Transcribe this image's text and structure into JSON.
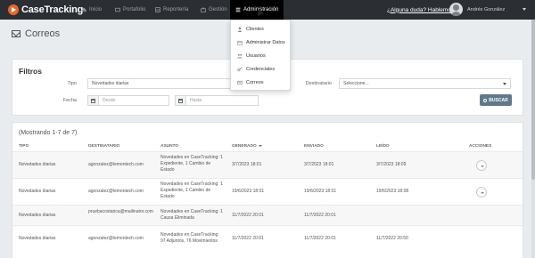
{
  "app": {
    "logo": "CaseTracking"
  },
  "nav": {
    "items": [
      {
        "label": "Inicio",
        "icon": "home-icon"
      },
      {
        "label": "Portafolio",
        "icon": "folder-icon"
      },
      {
        "label": "Reportería",
        "icon": "chart-icon"
      },
      {
        "label": "Gestión",
        "icon": "briefcase-icon"
      },
      {
        "label": "Administración",
        "icon": "menu-icon"
      }
    ],
    "help": "¿Alguna duda? Hablemos",
    "user": "Andrés González"
  },
  "page": {
    "title": "Correos",
    "icon": "envelope-icon"
  },
  "filters": {
    "title": "Filtros",
    "tipo_label": "Tipo",
    "tipo_value": "Novedades diarias",
    "destinatario_label": "Destinatario",
    "destinatario_value": "Seleccione...",
    "fecha_label": "Fecha",
    "desde_placeholder": "Desde",
    "hasta_placeholder": "Hasta",
    "search_button": "BUSCAR"
  },
  "results": {
    "count": "(Mostrando 1-7 de 7)",
    "columns": [
      "TIPO",
      "DESTINATARIO",
      "ASUNTO",
      "GENERADO",
      "ENVIADO",
      "LEÍDO",
      "ACCIONES"
    ],
    "rows": [
      {
        "tipo": "Novedades diarias",
        "destinatario": "agonzalez@lemontech.com",
        "asunto": "Novedades en CaseTracking: 1 Expediente, 1 Cambio de Estado",
        "generado": "3/7/2023 18:01",
        "enviado": "3/7/2023 18:01",
        "leido": "3/7/2023 18:09"
      },
      {
        "tipo": "Novedades diarias",
        "destinatario": "agonzalez@lemontech.com",
        "asunto": "Novedades en CaseTracking: 1 Expediente, 1 Cambio de Estado",
        "generado": "19/6/2023 18:01",
        "enviado": "19/6/2023 18:01",
        "leido": "19/6/2023 18:08"
      },
      {
        "tipo": "Novedades diarias",
        "destinatario": "pruebacostarica@mailinator.com",
        "asunto": "Novedades en CaseTracking: 1 Causa Eliminada",
        "generado": "11/7/2022 20:01",
        "enviado": "11/7/2022 20:01",
        "leido": ""
      },
      {
        "tipo": "Novedades diarias",
        "destinatario": "agonzalez@lemontech.com",
        "asunto": "Novedades en CaseTracking: 97 Adjuntos, 76 Movimientos",
        "generado": "11/7/2022 20:01",
        "enviado": "11/7/2022 20:01",
        "leido": "11/7/2022 20:50"
      }
    ]
  },
  "admin_menu": {
    "items": [
      {
        "label": "Clientes",
        "icon": "user-icon"
      },
      {
        "label": "Administrar Datos",
        "icon": "calendar-icon"
      },
      {
        "label": "Usuarios",
        "icon": "users-icon"
      },
      {
        "label": "Credenciales",
        "icon": "key-icon"
      },
      {
        "label": "Correos",
        "icon": "envelope-icon"
      }
    ]
  }
}
